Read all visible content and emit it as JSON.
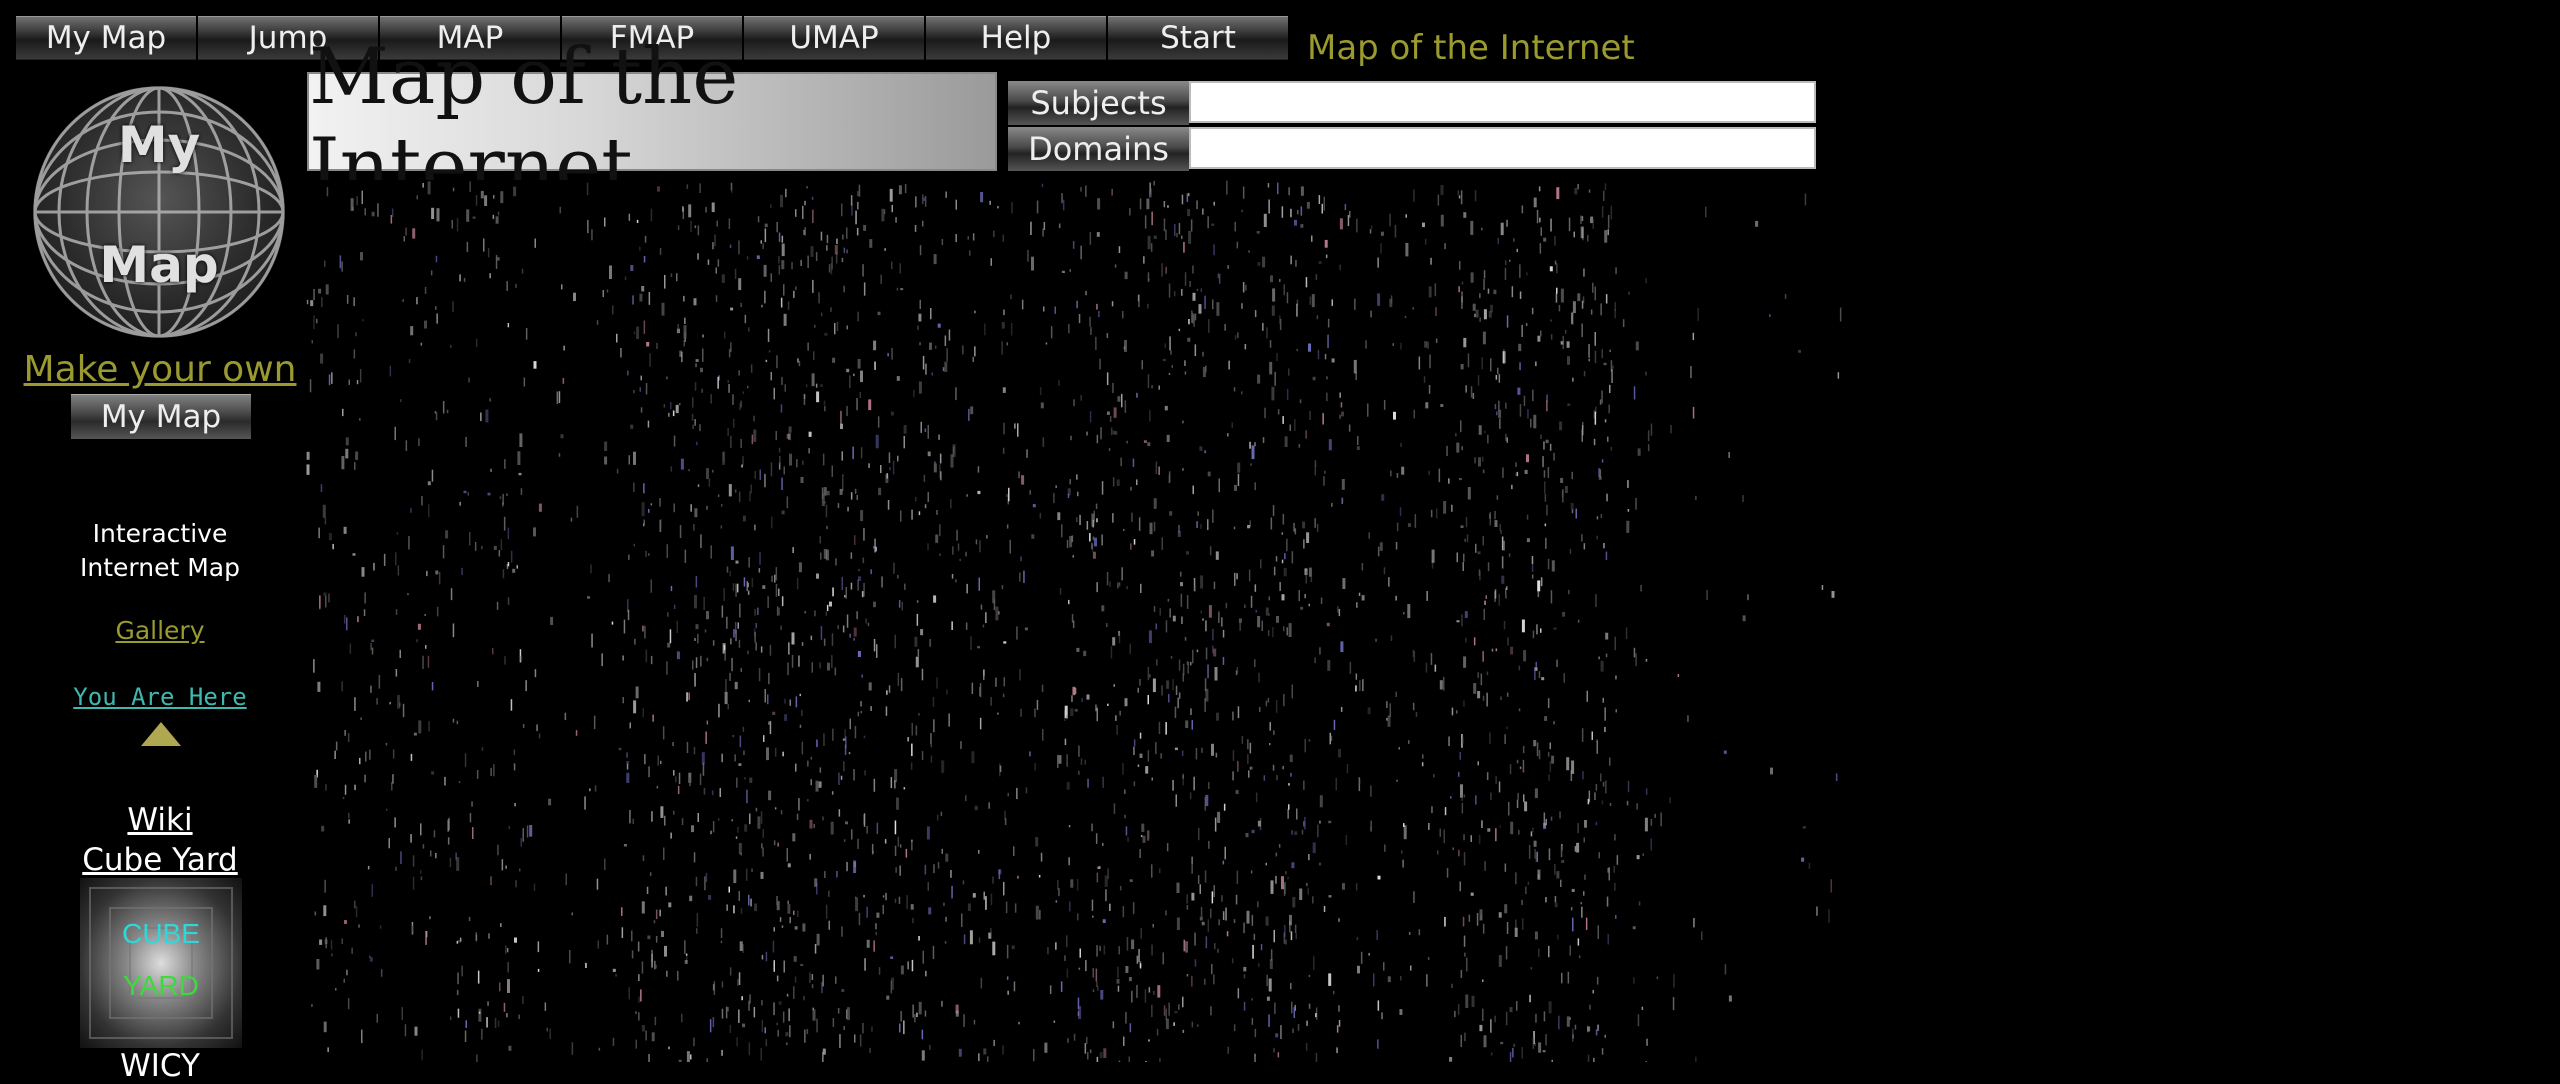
{
  "nav": {
    "buttons": [
      "My Map",
      "Jump",
      "MAP",
      "FMAP",
      "UMAP",
      "Help",
      "Start"
    ],
    "title": "Map of the Internet"
  },
  "sidebar": {
    "logo_line1": "My",
    "logo_line2": "Map",
    "make_your_own": "Make your own",
    "my_map_button": "My Map",
    "interactive_line1": "Interactive",
    "interactive_line2": "Internet Map",
    "gallery": "Gallery",
    "you_are_here": "You Are Here",
    "wiki": "Wiki",
    "cube_yard": "Cube Yard",
    "cube_word1": "CUBE",
    "cube_word2": "YARD",
    "wicy": "WICY"
  },
  "header": {
    "title": "Map of the Internet",
    "subjects_label": "Subjects",
    "subjects_value": "",
    "domains_label": "Domains",
    "domains_value": ""
  },
  "colors": {
    "background": "#000000",
    "link_olive": "#9a9a30",
    "link_teal": "#3fb8b0"
  }
}
